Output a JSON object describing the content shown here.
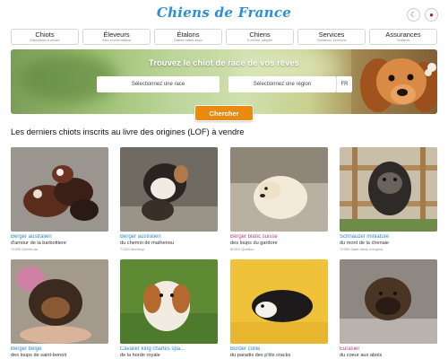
{
  "site": {
    "logo": "Chiens de France"
  },
  "header_icons": {
    "theme": "moon-icon",
    "account": "user-icon"
  },
  "nav": [
    {
      "title": "Chiots",
      "sub": "Disponibles à vendre"
    },
    {
      "title": "Éleveurs",
      "sub": "Infos et informations"
    },
    {
      "title": "Étalons",
      "sub": "Saillies mâles dispo"
    },
    {
      "title": "Chiens",
      "sub": "À vendre, adopter"
    },
    {
      "title": "Services",
      "sub": "Toiletteurs, pensions"
    },
    {
      "title": "Assurances",
      "sub": "Tarifaires"
    }
  ],
  "hero": {
    "title": "Trouvez le chiot de race de vos rêves",
    "race_placeholder": "Sélectionnez une race",
    "region_placeholder": "Sélectionnez une région",
    "country": "FR",
    "search_label": "Chercher"
  },
  "section_title": "Les derniers chiots inscrits au livre des origines (LOF) à vendre",
  "puppies": [
    {
      "breed": "Berger australien",
      "breeder": "d'amour de la barbottiere",
      "place": "72400 Cherre-au",
      "breed_color": "#2c8bc9"
    },
    {
      "breed": "Berger australien",
      "breeder": "du chemin de mathenou",
      "place": "71160 Montcoy",
      "breed_color": "#2c8bc9"
    },
    {
      "breed": "Berger blanc suisse",
      "breeder": "des loups du gardore",
      "place": "50310 Quettou",
      "breed_color": "#c23c8b"
    },
    {
      "breed": "Schnauzer miniature",
      "breeder": "du mont de la chenaie",
      "place": "72350 Saint denis d'orques",
      "breed_color": "#2c8bc9"
    },
    {
      "breed": "Berger belge",
      "breeder": "des loups de saint-benoit",
      "place": "",
      "breed_color": "#2c8bc9"
    },
    {
      "breed": "Cavalier king charles spa...",
      "breeder": "de la horde royale",
      "place": "",
      "breed_color": "#2c8bc9"
    },
    {
      "breed": "Border collie",
      "breeder": "du paradis des p'tits cracks",
      "place": "",
      "breed_color": "#2c8bc9"
    },
    {
      "breed": "Eurasier",
      "breeder": "du coeur aux abois",
      "place": "",
      "breed_color": "#c23c8b"
    }
  ]
}
